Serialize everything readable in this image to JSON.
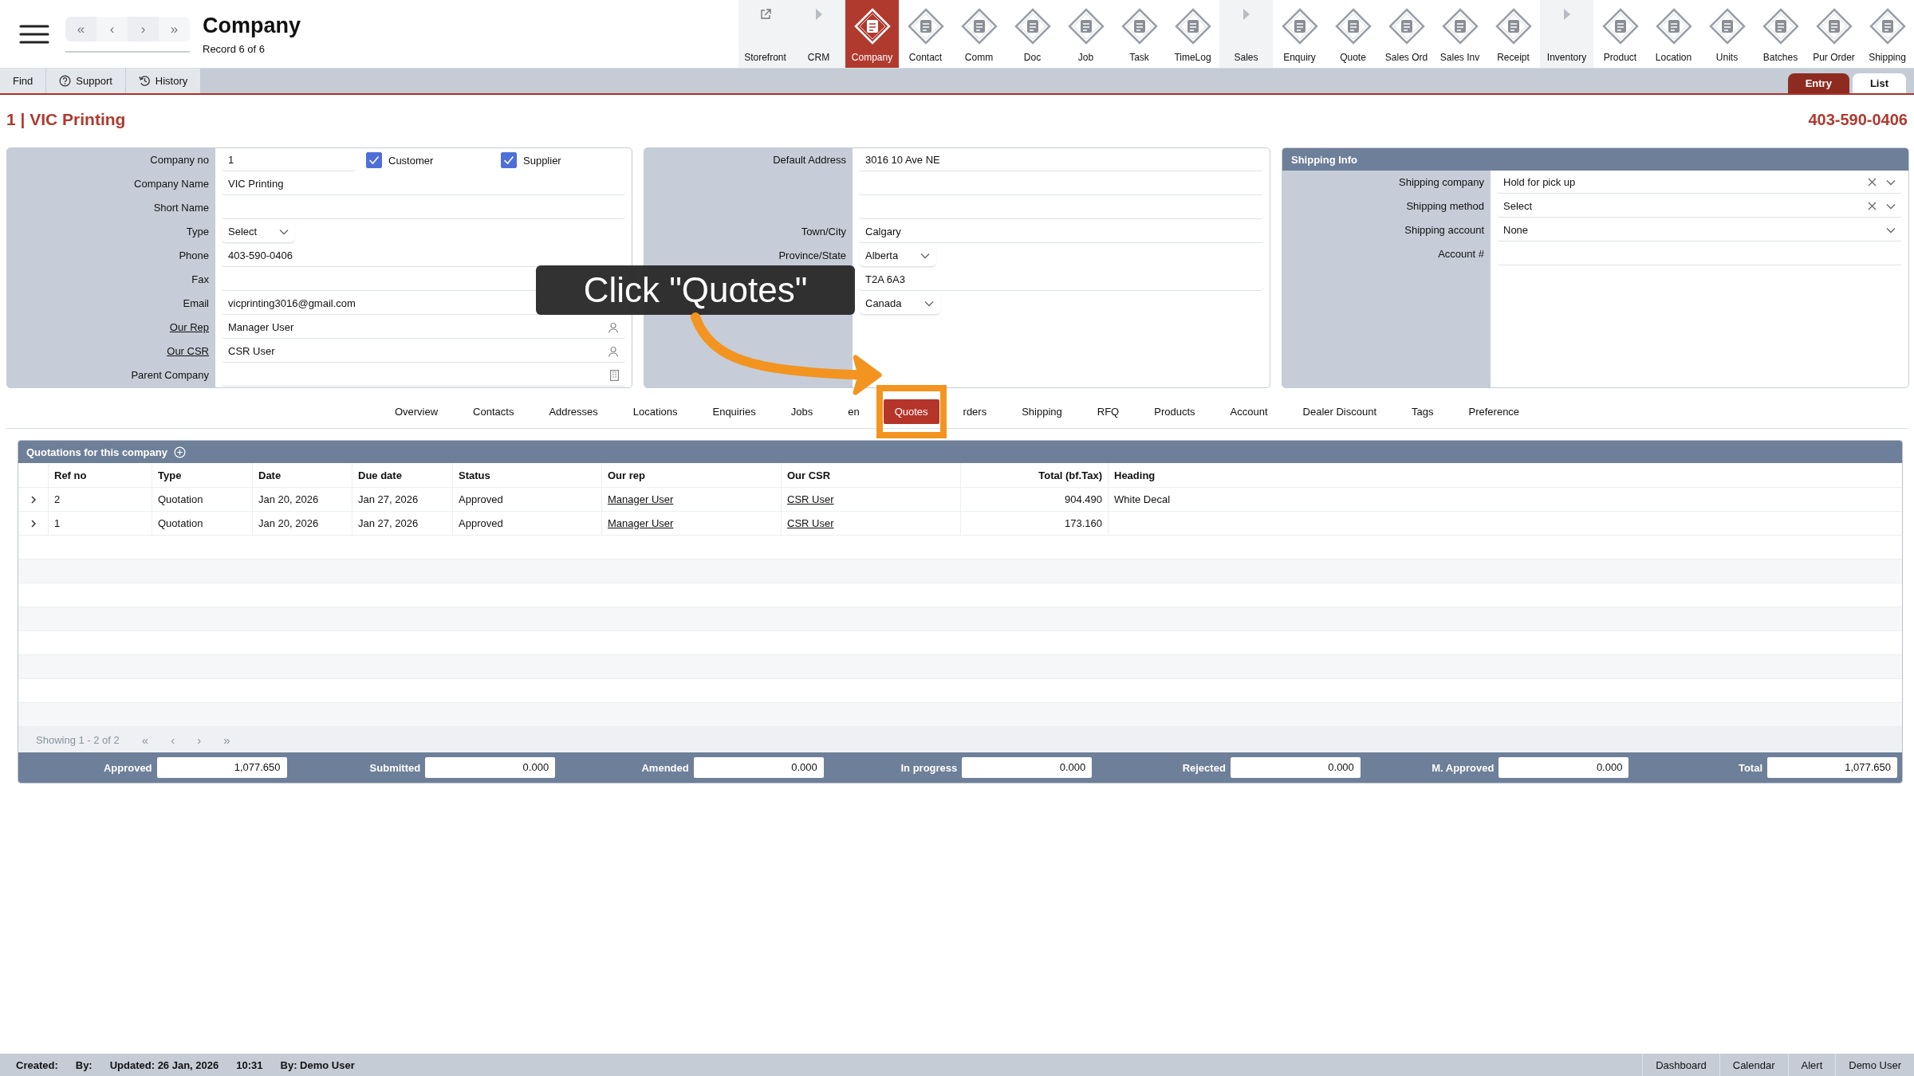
{
  "app_bar": {
    "title": "Company",
    "subtitle": "Record 6 of 6",
    "nav": [
      "«",
      "‹",
      "›",
      "»"
    ]
  },
  "modules": [
    {
      "label": "Storefront",
      "kind": "link",
      "selected": false
    },
    {
      "label": "CRM",
      "kind": "section",
      "selected": false
    },
    {
      "label": "Company",
      "kind": "module",
      "selected": true
    },
    {
      "label": "Contact",
      "kind": "module",
      "selected": false
    },
    {
      "label": "Comm",
      "kind": "module",
      "selected": false
    },
    {
      "label": "Doc",
      "kind": "module",
      "selected": false
    },
    {
      "label": "Job",
      "kind": "module",
      "selected": false
    },
    {
      "label": "Task",
      "kind": "module",
      "selected": false
    },
    {
      "label": "TimeLog",
      "kind": "module",
      "selected": false
    },
    {
      "label": "Sales",
      "kind": "section",
      "selected": false
    },
    {
      "label": "Enquiry",
      "kind": "module",
      "selected": false
    },
    {
      "label": "Quote",
      "kind": "module",
      "selected": false
    },
    {
      "label": "Sales Ord",
      "kind": "module",
      "selected": false
    },
    {
      "label": "Sales Inv",
      "kind": "module",
      "selected": false
    },
    {
      "label": "Receipt",
      "kind": "module",
      "selected": false
    },
    {
      "label": "Inventory",
      "kind": "section",
      "selected": false
    },
    {
      "label": "Product",
      "kind": "module",
      "selected": false
    },
    {
      "label": "Location",
      "kind": "module",
      "selected": false
    },
    {
      "label": "Units",
      "kind": "module",
      "selected": false
    },
    {
      "label": "Batches",
      "kind": "module",
      "selected": false
    },
    {
      "label": "Pur Order",
      "kind": "module",
      "selected": false
    },
    {
      "label": "Shipping",
      "kind": "module",
      "selected": false
    }
  ],
  "toolbar": {
    "buttons": [
      {
        "label": "Find",
        "kind": "plain"
      },
      {
        "label": "Support",
        "kind": "help"
      },
      {
        "label": "History",
        "kind": "history"
      }
    ],
    "views": [
      {
        "label": "Entry",
        "selected": true
      },
      {
        "label": "List",
        "selected": false
      }
    ]
  },
  "record": {
    "title": "1 | VIC Printing",
    "phone": "403-590-0406"
  },
  "company_panel": {
    "fields": [
      {
        "kind": "flags",
        "label": "Company no",
        "value": "1",
        "flags": [
          {
            "label": "Customer",
            "checked": true
          },
          {
            "label": "Supplier",
            "checked": true
          }
        ]
      },
      {
        "kind": "text",
        "label": "Company Name",
        "value": "VIC Printing"
      },
      {
        "kind": "text",
        "label": "Short Name"
      },
      {
        "kind": "select",
        "label": "Type",
        "value": "Select"
      },
      {
        "kind": "text",
        "label": "Phone",
        "value": "403-590-0406"
      },
      {
        "kind": "text",
        "label": "Fax"
      },
      {
        "kind": "text",
        "label": "Email",
        "value": "vicprinting3016@gmail.com"
      },
      {
        "kind": "person",
        "label": "Our Rep",
        "value": "Manager User",
        "link": true
      },
      {
        "kind": "person",
        "label": "Our CSR",
        "value": "CSR User",
        "link": true
      },
      {
        "kind": "lookup",
        "label": "Parent Company"
      }
    ]
  },
  "address_panel": {
    "fields": [
      {
        "kind": "text",
        "label": "Default Address",
        "value": "3016 10 Ave NE"
      },
      {
        "kind": "text"
      },
      {
        "kind": "text"
      },
      {
        "kind": "text",
        "label": "Town/City",
        "value": "Calgary"
      },
      {
        "kind": "select",
        "label": "Province/State",
        "value": "Alberta"
      },
      {
        "kind": "text",
        "value": "T2A 6A3"
      },
      {
        "kind": "select",
        "value": "Canada"
      }
    ]
  },
  "shipping_panel": {
    "title": "Shipping Info",
    "fields": [
      {
        "kind": "combo",
        "label": "Shipping company",
        "value": "Hold for pick up",
        "clearable": true
      },
      {
        "kind": "combo",
        "label": "Shipping method",
        "value": "Select",
        "clearable": true
      },
      {
        "kind": "combo",
        "label": "Shipping account",
        "value": "None",
        "clearable": false
      },
      {
        "kind": "text",
        "label": "Account #"
      }
    ]
  },
  "tabs": [
    {
      "label": "Overview",
      "selected": false,
      "highlighted": false
    },
    {
      "label": "Contacts",
      "selected": false,
      "highlighted": false
    },
    {
      "label": "Addresses",
      "selected": false,
      "highlighted": false
    },
    {
      "label": "Locations",
      "selected": false,
      "highlighted": false
    },
    {
      "label": "Enquiries",
      "selected": false,
      "highlighted": false
    },
    {
      "label": "Jobs",
      "selected": false,
      "highlighted": false
    },
    {
      "label": "en",
      "selected": false,
      "highlighted": false
    },
    {
      "label": "Quotes",
      "selected": true,
      "highlighted": true
    },
    {
      "label": "rders",
      "selected": false,
      "highlighted": false
    },
    {
      "label": "Shipping",
      "selected": false,
      "highlighted": false
    },
    {
      "label": "RFQ",
      "selected": false,
      "highlighted": false
    },
    {
      "label": "Products",
      "selected": false,
      "highlighted": false
    },
    {
      "label": "Account",
      "selected": false,
      "highlighted": false
    },
    {
      "label": "Dealer Discount",
      "selected": false,
      "highlighted": false
    },
    {
      "label": "Tags",
      "selected": false,
      "highlighted": false
    },
    {
      "label": "Preference",
      "selected": false,
      "highlighted": false
    }
  ],
  "quotes": {
    "title": "Quotations for this company",
    "columns": [
      {
        "label": "Ref no",
        "kind": "text"
      },
      {
        "label": "Type",
        "kind": "text"
      },
      {
        "label": "Date",
        "kind": "text"
      },
      {
        "label": "Due date",
        "kind": "text"
      },
      {
        "label": "Status",
        "kind": "text"
      },
      {
        "label": "Our rep",
        "kind": "link"
      },
      {
        "label": "Our CSR",
        "kind": "link"
      },
      {
        "label": "Total (bf.Tax)",
        "kind": "number"
      },
      {
        "label": "Heading",
        "kind": "text"
      }
    ],
    "rows": [
      {
        "expanded": false,
        "cells": [
          "2",
          "Quotation",
          "Jan 20, 2026",
          "Jan 27, 2026",
          "Approved",
          "Manager User",
          "CSR User",
          "904.490",
          "White Decal"
        ]
      },
      {
        "expanded": false,
        "cells": [
          "1",
          "Quotation",
          "Jan 20, 2026",
          "Jan 27, 2026",
          "Approved",
          "Manager User",
          "CSR User",
          "173.160"
        ]
      }
    ],
    "pager": {
      "summary": "Showing 1 - 2 of 2",
      "buttons": [
        "«",
        "‹",
        "›",
        "»"
      ]
    },
    "totals": [
      {
        "label": "Approved",
        "value": "1,077.650"
      },
      {
        "label": "Submitted",
        "value": "0.000"
      },
      {
        "label": "Amended",
        "value": "0.000"
      },
      {
        "label": "In progress",
        "value": "0.000"
      },
      {
        "label": "Rejected",
        "value": "0.000"
      },
      {
        "label": "M. Approved",
        "value": "0.000"
      },
      {
        "label": "Total",
        "value": "1,077.650"
      }
    ]
  },
  "status_bar": {
    "left": [
      "Created:",
      "By:",
      "Updated: 26 Jan, 2026",
      "10:31",
      "By: Demo User"
    ],
    "right": [
      "Dashboard",
      "Calendar",
      "Alert",
      "Demo User"
    ]
  },
  "callout": {
    "text": "Click \"Quotes\""
  }
}
